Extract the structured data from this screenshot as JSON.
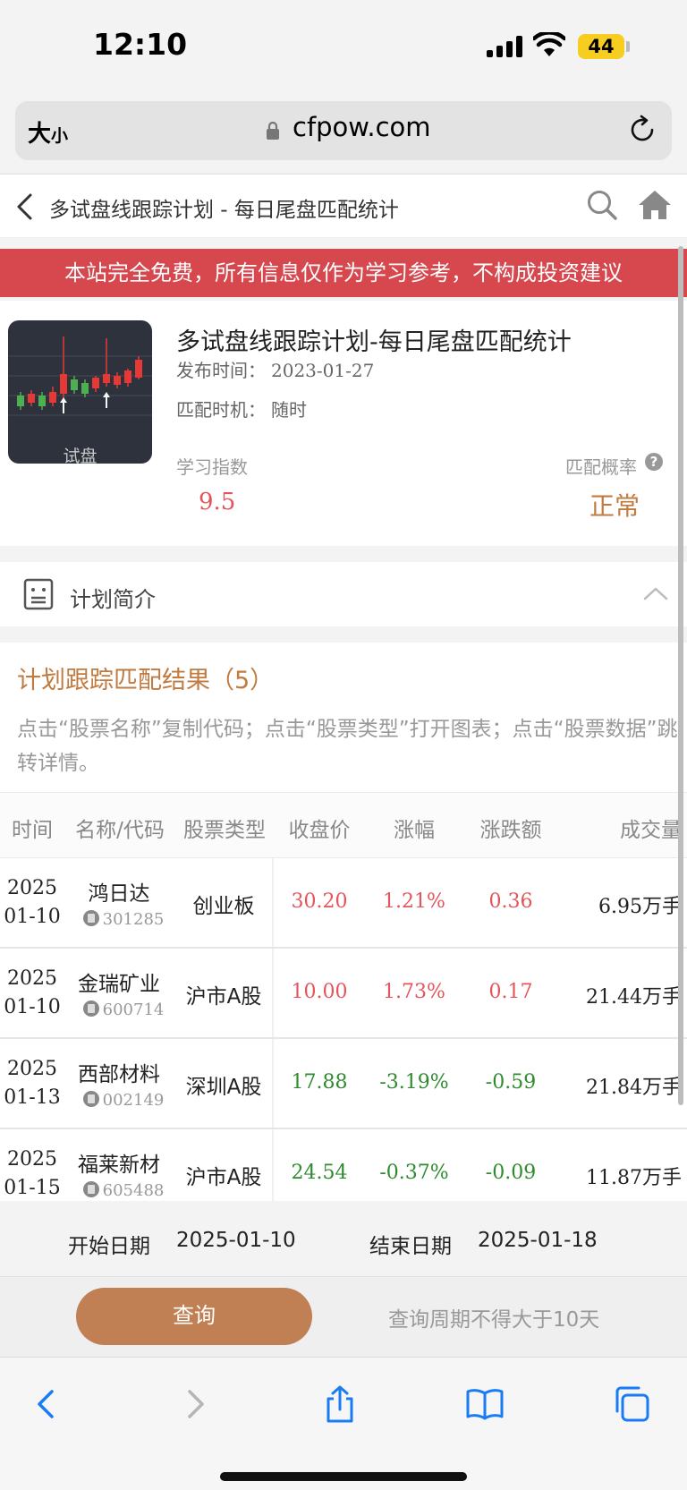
{
  "status_bar": {
    "time": "12:10",
    "battery": "44"
  },
  "url_bar": {
    "text_size_label": "大",
    "text_size_small": "小",
    "url": "cfpow.com"
  },
  "header": {
    "title": "多试盘线跟踪计划 - 每日尾盘匹配统计"
  },
  "notice": "本站完全免费，所有信息仅作为学习参考，不构成投资建议",
  "plan": {
    "thumb_label": "试盘",
    "title": "多试盘线跟踪计划-每日尾盘匹配统计",
    "publish_label": "发布时间：",
    "publish_date": "2023-01-27",
    "match_label": "匹配时机：",
    "match_value": "随时",
    "study_label": "学习指数",
    "study_value": "9.5",
    "prob_label": "匹配概率",
    "prob_help": "?",
    "prob_value": "正常"
  },
  "intro": {
    "label": "计划简介"
  },
  "results": {
    "title": "计划跟踪匹配结果（5）",
    "hint": "点击“股票名称”复制代码；点击“股票类型”打开图表；点击“股票数据”跳转详情。"
  },
  "table": {
    "headers": [
      "时间",
      "名称/代码",
      "股票类型",
      "收盘价",
      "涨幅",
      "涨跌额",
      "成交量"
    ],
    "rows": [
      {
        "year": "2025",
        "date": "01-10",
        "name": "鸿日达",
        "code": "301285",
        "type": "创业板",
        "close": "30.20",
        "pct": "1.21%",
        "chg": "0.36",
        "vol": "6.95万手",
        "trend": "up"
      },
      {
        "year": "2025",
        "date": "01-10",
        "name": "金瑞矿业",
        "code": "600714",
        "type": "沪市A股",
        "close": "10.00",
        "pct": "1.73%",
        "chg": "0.17",
        "vol": "21.44万手",
        "trend": "up"
      },
      {
        "year": "2025",
        "date": "01-13",
        "name": "西部材料",
        "code": "002149",
        "type": "深圳A股",
        "close": "17.88",
        "pct": "-3.19%",
        "chg": "-0.59",
        "vol": "21.84万手",
        "trend": "down"
      },
      {
        "year": "2025",
        "date": "01-15",
        "name": "福莱新材",
        "code": "605488",
        "type": "沪市A股",
        "close": "24.54",
        "pct": "-0.37%",
        "chg": "-0.09",
        "vol": "11.87万手",
        "trend": "down"
      }
    ]
  },
  "query": {
    "start_label": "开始日期",
    "start_date": "2025-01-10",
    "end_label": "结束日期",
    "end_date": "2025-01-18",
    "button": "查询",
    "note": "查询周期不得大于10天"
  },
  "colors": {
    "accent": "#c17a3f",
    "up": "#e4545a",
    "down": "#2e8b2e",
    "notice": "#d6474e",
    "button": "#c08053"
  }
}
